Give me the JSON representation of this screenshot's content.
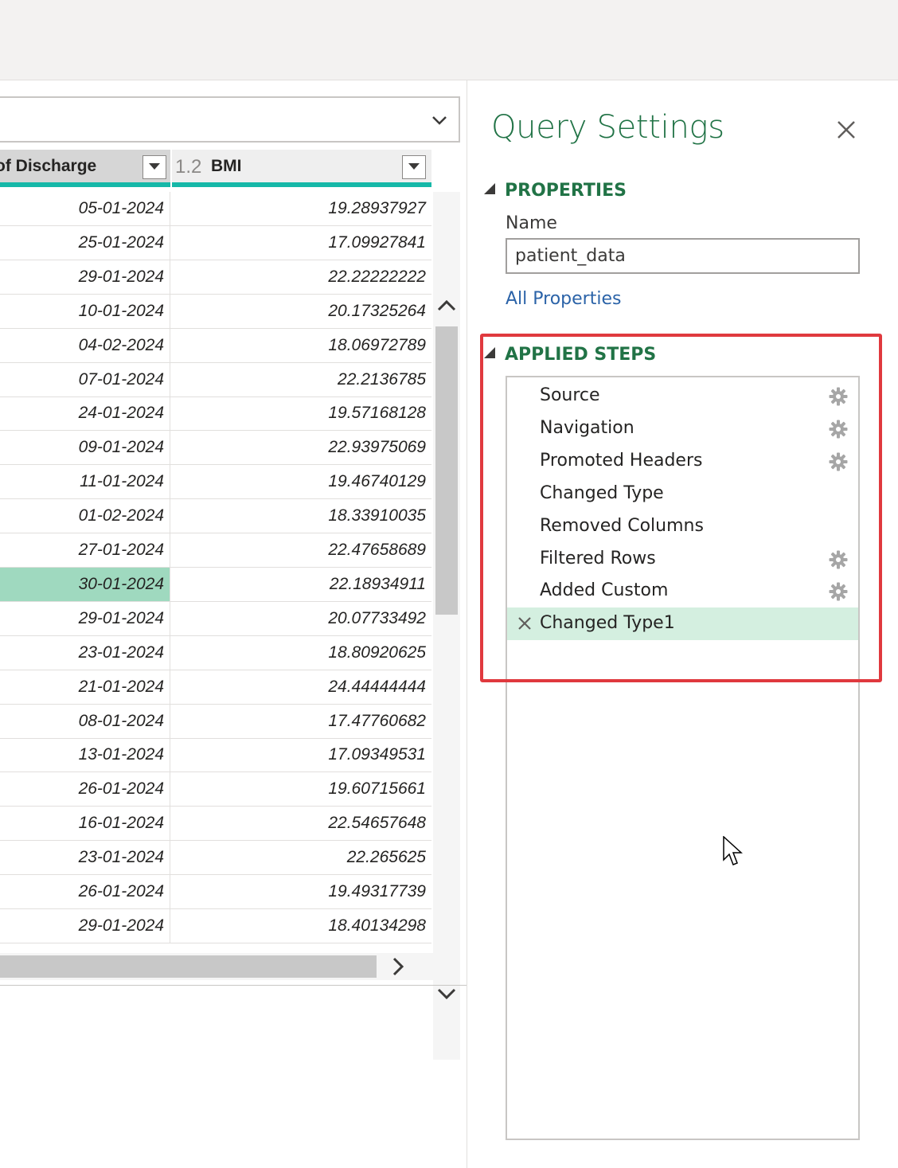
{
  "grid": {
    "columns": [
      {
        "type_icon": "",
        "label": "of Discharge"
      },
      {
        "type_icon": "1.2",
        "label": "BMI"
      }
    ],
    "rows": [
      {
        "date": "05-01-2024",
        "bmi": "19.28937927"
      },
      {
        "date": "25-01-2024",
        "bmi": "17.09927841"
      },
      {
        "date": "29-01-2024",
        "bmi": "22.22222222"
      },
      {
        "date": "10-01-2024",
        "bmi": "20.17325264"
      },
      {
        "date": "04-02-2024",
        "bmi": "18.06972789"
      },
      {
        "date": "07-01-2024",
        "bmi": "22.2136785"
      },
      {
        "date": "24-01-2024",
        "bmi": "19.57168128"
      },
      {
        "date": "09-01-2024",
        "bmi": "22.93975069"
      },
      {
        "date": "11-01-2024",
        "bmi": "19.46740129"
      },
      {
        "date": "01-02-2024",
        "bmi": "18.33910035"
      },
      {
        "date": "27-01-2024",
        "bmi": "22.47658689"
      },
      {
        "date": "30-01-2024",
        "bmi": "22.18934911"
      },
      {
        "date": "29-01-2024",
        "bmi": "20.07733492"
      },
      {
        "date": "23-01-2024",
        "bmi": "18.80920625"
      },
      {
        "date": "21-01-2024",
        "bmi": "24.44444444"
      },
      {
        "date": "08-01-2024",
        "bmi": "17.47760682"
      },
      {
        "date": "13-01-2024",
        "bmi": "17.09349531"
      },
      {
        "date": "26-01-2024",
        "bmi": "19.60715661"
      },
      {
        "date": "16-01-2024",
        "bmi": "22.54657648"
      },
      {
        "date": "23-01-2024",
        "bmi": "22.265625"
      },
      {
        "date": "26-01-2024",
        "bmi": "19.49317739"
      },
      {
        "date": "29-01-2024",
        "bmi": "18.40134298"
      }
    ],
    "selected_row": 11
  },
  "settings": {
    "title": "Query Settings",
    "properties_heading": "PROPERTIES",
    "name_label": "Name",
    "name_value": "patient_data",
    "all_properties_link": "All Properties",
    "steps_heading": "APPLIED STEPS",
    "steps": [
      {
        "label": "Source",
        "has_gear": true
      },
      {
        "label": "Navigation",
        "has_gear": true
      },
      {
        "label": "Promoted Headers",
        "has_gear": true
      },
      {
        "label": "Changed Type",
        "has_gear": false
      },
      {
        "label": "Removed Columns",
        "has_gear": false
      },
      {
        "label": "Filtered Rows",
        "has_gear": true
      },
      {
        "label": "Added Custom",
        "has_gear": true
      },
      {
        "label": "Changed Type1",
        "has_gear": false,
        "active": true
      }
    ]
  },
  "colors": {
    "accent_green": "#217346",
    "highlight_red": "#e0393e",
    "column_underline": "#16b8a8",
    "selected_cell": "#9fd9bf"
  }
}
